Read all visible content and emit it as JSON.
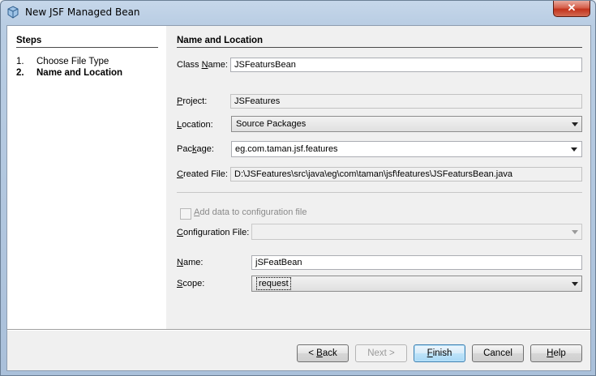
{
  "window": {
    "title": "New JSF Managed Bean",
    "close_glyph": "✕"
  },
  "steps": {
    "title": "Steps",
    "items": [
      {
        "num": "1.",
        "label": "Choose File Type"
      },
      {
        "num": "2.",
        "label": "Name and Location"
      }
    ]
  },
  "panel": {
    "title": "Name and Location",
    "class_name": {
      "label_pre": "Class ",
      "label_mn": "N",
      "label_post": "ame:",
      "value": "JSFeatursBean"
    },
    "project": {
      "label_pre": "",
      "label_mn": "P",
      "label_post": "roject:",
      "value": "JSFeatures"
    },
    "location": {
      "label_pre": "",
      "label_mn": "L",
      "label_post": "ocation:",
      "value": "Source Packages"
    },
    "package": {
      "label_pre": "Pac",
      "label_mn": "k",
      "label_post": "age:",
      "value": "eg.com.taman.jsf.features"
    },
    "created_file": {
      "label_pre": "",
      "label_mn": "C",
      "label_post": "reated File:",
      "value": "D:\\JSFeatures\\src\\java\\eg\\com\\taman\\jsf\\features\\JSFeatursBean.java"
    },
    "add_config": {
      "label_pre": "",
      "label_mn": "A",
      "label_post": "dd data to configuration file",
      "checked": false
    },
    "config_file": {
      "label_pre": "",
      "label_mn": "C",
      "label_post": "onfiguration File:",
      "value": ""
    },
    "name": {
      "label_pre": "",
      "label_mn": "N",
      "label_post": "ame:",
      "value": "jSFeatBean"
    },
    "scope": {
      "label_pre": "",
      "label_mn": "S",
      "label_post": "cope:",
      "value": "request"
    }
  },
  "buttons": {
    "back": {
      "pre": "< ",
      "mn": "B",
      "post": "ack"
    },
    "next": "Next >",
    "finish": {
      "pre": "",
      "mn": "F",
      "post": "inish"
    },
    "cancel": "Cancel",
    "help": {
      "pre": "",
      "mn": "H",
      "post": "elp"
    }
  }
}
